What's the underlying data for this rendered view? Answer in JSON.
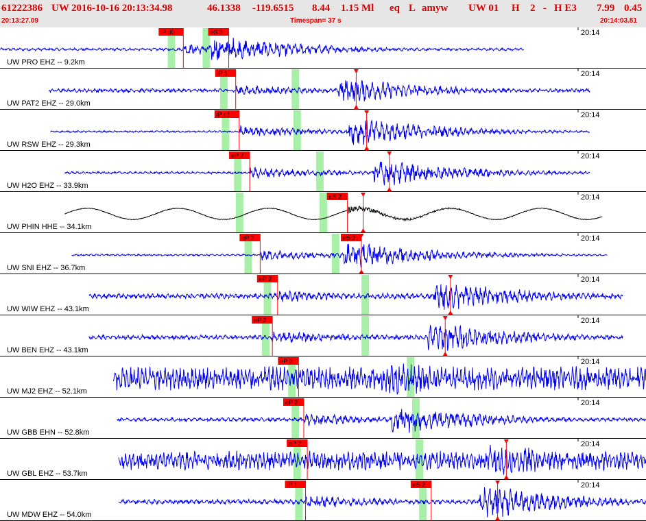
{
  "header": {
    "event_id": "61222386",
    "network": "UW",
    "datetime": "2016-10-16 20:13:34.98",
    "latitude": "46.1338",
    "longitude": "-119.6515",
    "depth": "8.44",
    "magnitude": "1.15 Ml",
    "event_type": "eq",
    "origin_flag": "L",
    "analyst": "amyw",
    "source": "UW 01",
    "quality_h": "H",
    "quality_n": "2",
    "dash": "-",
    "grade": "H E3",
    "rms": "7.99",
    "err": "0.45",
    "start_time": "20:13:27.09",
    "timespan": "Timespan=  37 s",
    "end_time": "20:14:03.81"
  },
  "colors": {
    "trace": "#0000ee",
    "broadband_trace": "#000000",
    "pick": "#ff0000",
    "window": "#a8f0a8",
    "header_text": "#dd0000",
    "header_band": "#e6e6e6"
  },
  "chart_data": {
    "type": "line",
    "title": "61222386 UW 2016-10-16 20:13:34.98",
    "xlim": [
      0,
      37
    ],
    "x_unit": "s",
    "traces": [
      {
        "label": "UW PRO EHZ -- 9.2km",
        "time_tick": "20:14",
        "component_kind": "short-period",
        "data_start": 0.0,
        "data_end": 30.0,
        "amplitude": 0.55,
        "noise": 0.06,
        "period_s": 0.35,
        "windows": [
          9.8,
          11.8
        ],
        "picks": [
          {
            "label": "iP d0",
            "time": 10.5,
            "marker": "none"
          },
          {
            "label": "eS 2",
            "time": 13.1,
            "marker": "none"
          }
        ]
      },
      {
        "label": "UW PAT2 EHZ -- 29.0km",
        "time_tick": "20:14",
        "component_kind": "short-period",
        "data_start": 2.8,
        "data_end": 33.8,
        "amplitude": 0.5,
        "noise": 0.08,
        "period_s": 0.3,
        "windows": [
          12.8,
          16.9
        ],
        "picks": [
          {
            "label": "iP 1",
            "time": 13.5,
            "marker": "none"
          },
          {
            "label": "",
            "time": 20.4,
            "marker": "triangle"
          }
        ]
      },
      {
        "label": "UW RSW EHZ -- 29.3km",
        "time_tick": "20:14",
        "component_kind": "short-period",
        "data_start": 2.9,
        "data_end": 33.8,
        "amplitude": 0.55,
        "noise": 0.04,
        "period_s": 0.3,
        "windows": [
          12.9,
          17.0
        ],
        "picks": [
          {
            "label": "iP c1",
            "time": 13.7,
            "marker": "none"
          },
          {
            "label": "",
            "time": 21.0,
            "marker": "triangle"
          }
        ]
      },
      {
        "label": "UW H2O EHZ -- 33.9km",
        "time_tick": "20:14",
        "component_kind": "short-period",
        "data_start": 3.7,
        "data_end": 33.8,
        "amplitude": 0.55,
        "noise": 0.05,
        "period_s": 0.3,
        "windows": [
          13.6,
          18.3
        ],
        "picks": [
          {
            "label": "eP 2",
            "time": 14.3,
            "marker": "none"
          },
          {
            "label": "",
            "time": 22.3,
            "marker": "triangle"
          }
        ]
      },
      {
        "label": "UW PHIN HHE -- 34.1km",
        "time_tick": "20:14",
        "component_kind": "broadband",
        "data_start": 3.7,
        "data_end": 34.5,
        "amplitude": 0.35,
        "noise": 0.06,
        "period_s": 5.2,
        "windows": [
          13.7,
          18.5
        ],
        "picks": [
          {
            "label": "eS 2",
            "time": 19.9,
            "marker": "none"
          },
          {
            "label": "",
            "time": 20.8,
            "marker": "triangle"
          }
        ]
      },
      {
        "label": "UW SNI EHZ -- 36.7km",
        "time_tick": "20:14",
        "component_kind": "short-period",
        "data_start": 4.1,
        "data_end": 34.8,
        "amplitude": 0.55,
        "noise": 0.04,
        "period_s": 0.3,
        "windows": [
          14.2,
          19.2
        ],
        "picks": [
          {
            "label": "eP 2",
            "time": 14.9,
            "marker": "none"
          },
          {
            "label": "eS 2",
            "time": 20.7,
            "marker": "triangle"
          }
        ]
      },
      {
        "label": "UW WIW EHZ -- 43.1km",
        "time_tick": "20:14",
        "component_kind": "short-period",
        "data_start": 5.1,
        "data_end": 35.7,
        "amplitude": 0.6,
        "noise": 0.12,
        "period_s": 0.28,
        "windows": [
          15.3,
          20.9
        ],
        "picks": [
          {
            "label": "eP 2",
            "time": 15.9,
            "marker": "none"
          },
          {
            "label": "",
            "time": 25.8,
            "marker": "triangle"
          }
        ]
      },
      {
        "label": "UW BEN EHZ -- 43.1km",
        "time_tick": "20:14",
        "component_kind": "short-period",
        "data_start": 5.1,
        "data_end": 35.7,
        "amplitude": 0.6,
        "noise": 0.1,
        "period_s": 0.28,
        "windows": [
          15.2,
          20.9
        ],
        "picks": [
          {
            "label": "eP 2",
            "time": 15.6,
            "marker": "none"
          },
          {
            "label": "",
            "time": 25.5,
            "marker": "triangle"
          }
        ]
      },
      {
        "label": "UW MJ2 EHZ -- 52.1km",
        "time_tick": "20:14",
        "component_kind": "short-period",
        "data_start": 6.5,
        "data_end": 37.0,
        "amplitude": 0.75,
        "noise": 0.5,
        "period_s": 0.22,
        "windows": [
          16.7,
          23.5
        ],
        "picks": [
          {
            "label": "eP 2",
            "time": 17.1,
            "marker": "none"
          }
        ]
      },
      {
        "label": "UW GBB EHN -- 52.8km",
        "time_tick": "20:14",
        "component_kind": "short-period",
        "data_start": 6.7,
        "data_end": 37.0,
        "amplitude": 0.6,
        "noise": 0.08,
        "period_s": 0.32,
        "windows": [
          16.9,
          23.8
        ],
        "picks": [
          {
            "label": "eP 2",
            "time": 17.4,
            "marker": "none"
          }
        ]
      },
      {
        "label": "UW GBL EHZ -- 53.7km",
        "time_tick": "20:14",
        "component_kind": "short-period",
        "data_start": 6.8,
        "data_end": 37.0,
        "amplitude": 0.7,
        "noise": 0.4,
        "period_s": 0.22,
        "windows": [
          17.0,
          24.0
        ],
        "picks": [
          {
            "label": "eP 2",
            "time": 17.6,
            "marker": "none"
          },
          {
            "label": "",
            "time": 29.0,
            "marker": "triangle"
          }
        ]
      },
      {
        "label": "UW MDW EHZ -- 54.0km",
        "time_tick": "20:14",
        "component_kind": "short-period",
        "data_start": 6.8,
        "data_end": 37.0,
        "amplitude": 0.65,
        "noise": 0.1,
        "period_s": 0.3,
        "windows": [
          17.1,
          24.2
        ],
        "picks": [
          {
            "label": "iP 1",
            "time": 17.5,
            "marker": "none"
          },
          {
            "label": "eS 2",
            "time": 24.7,
            "marker": "none"
          },
          {
            "label": "",
            "time": 28.5,
            "marker": "triangle"
          }
        ]
      }
    ]
  }
}
